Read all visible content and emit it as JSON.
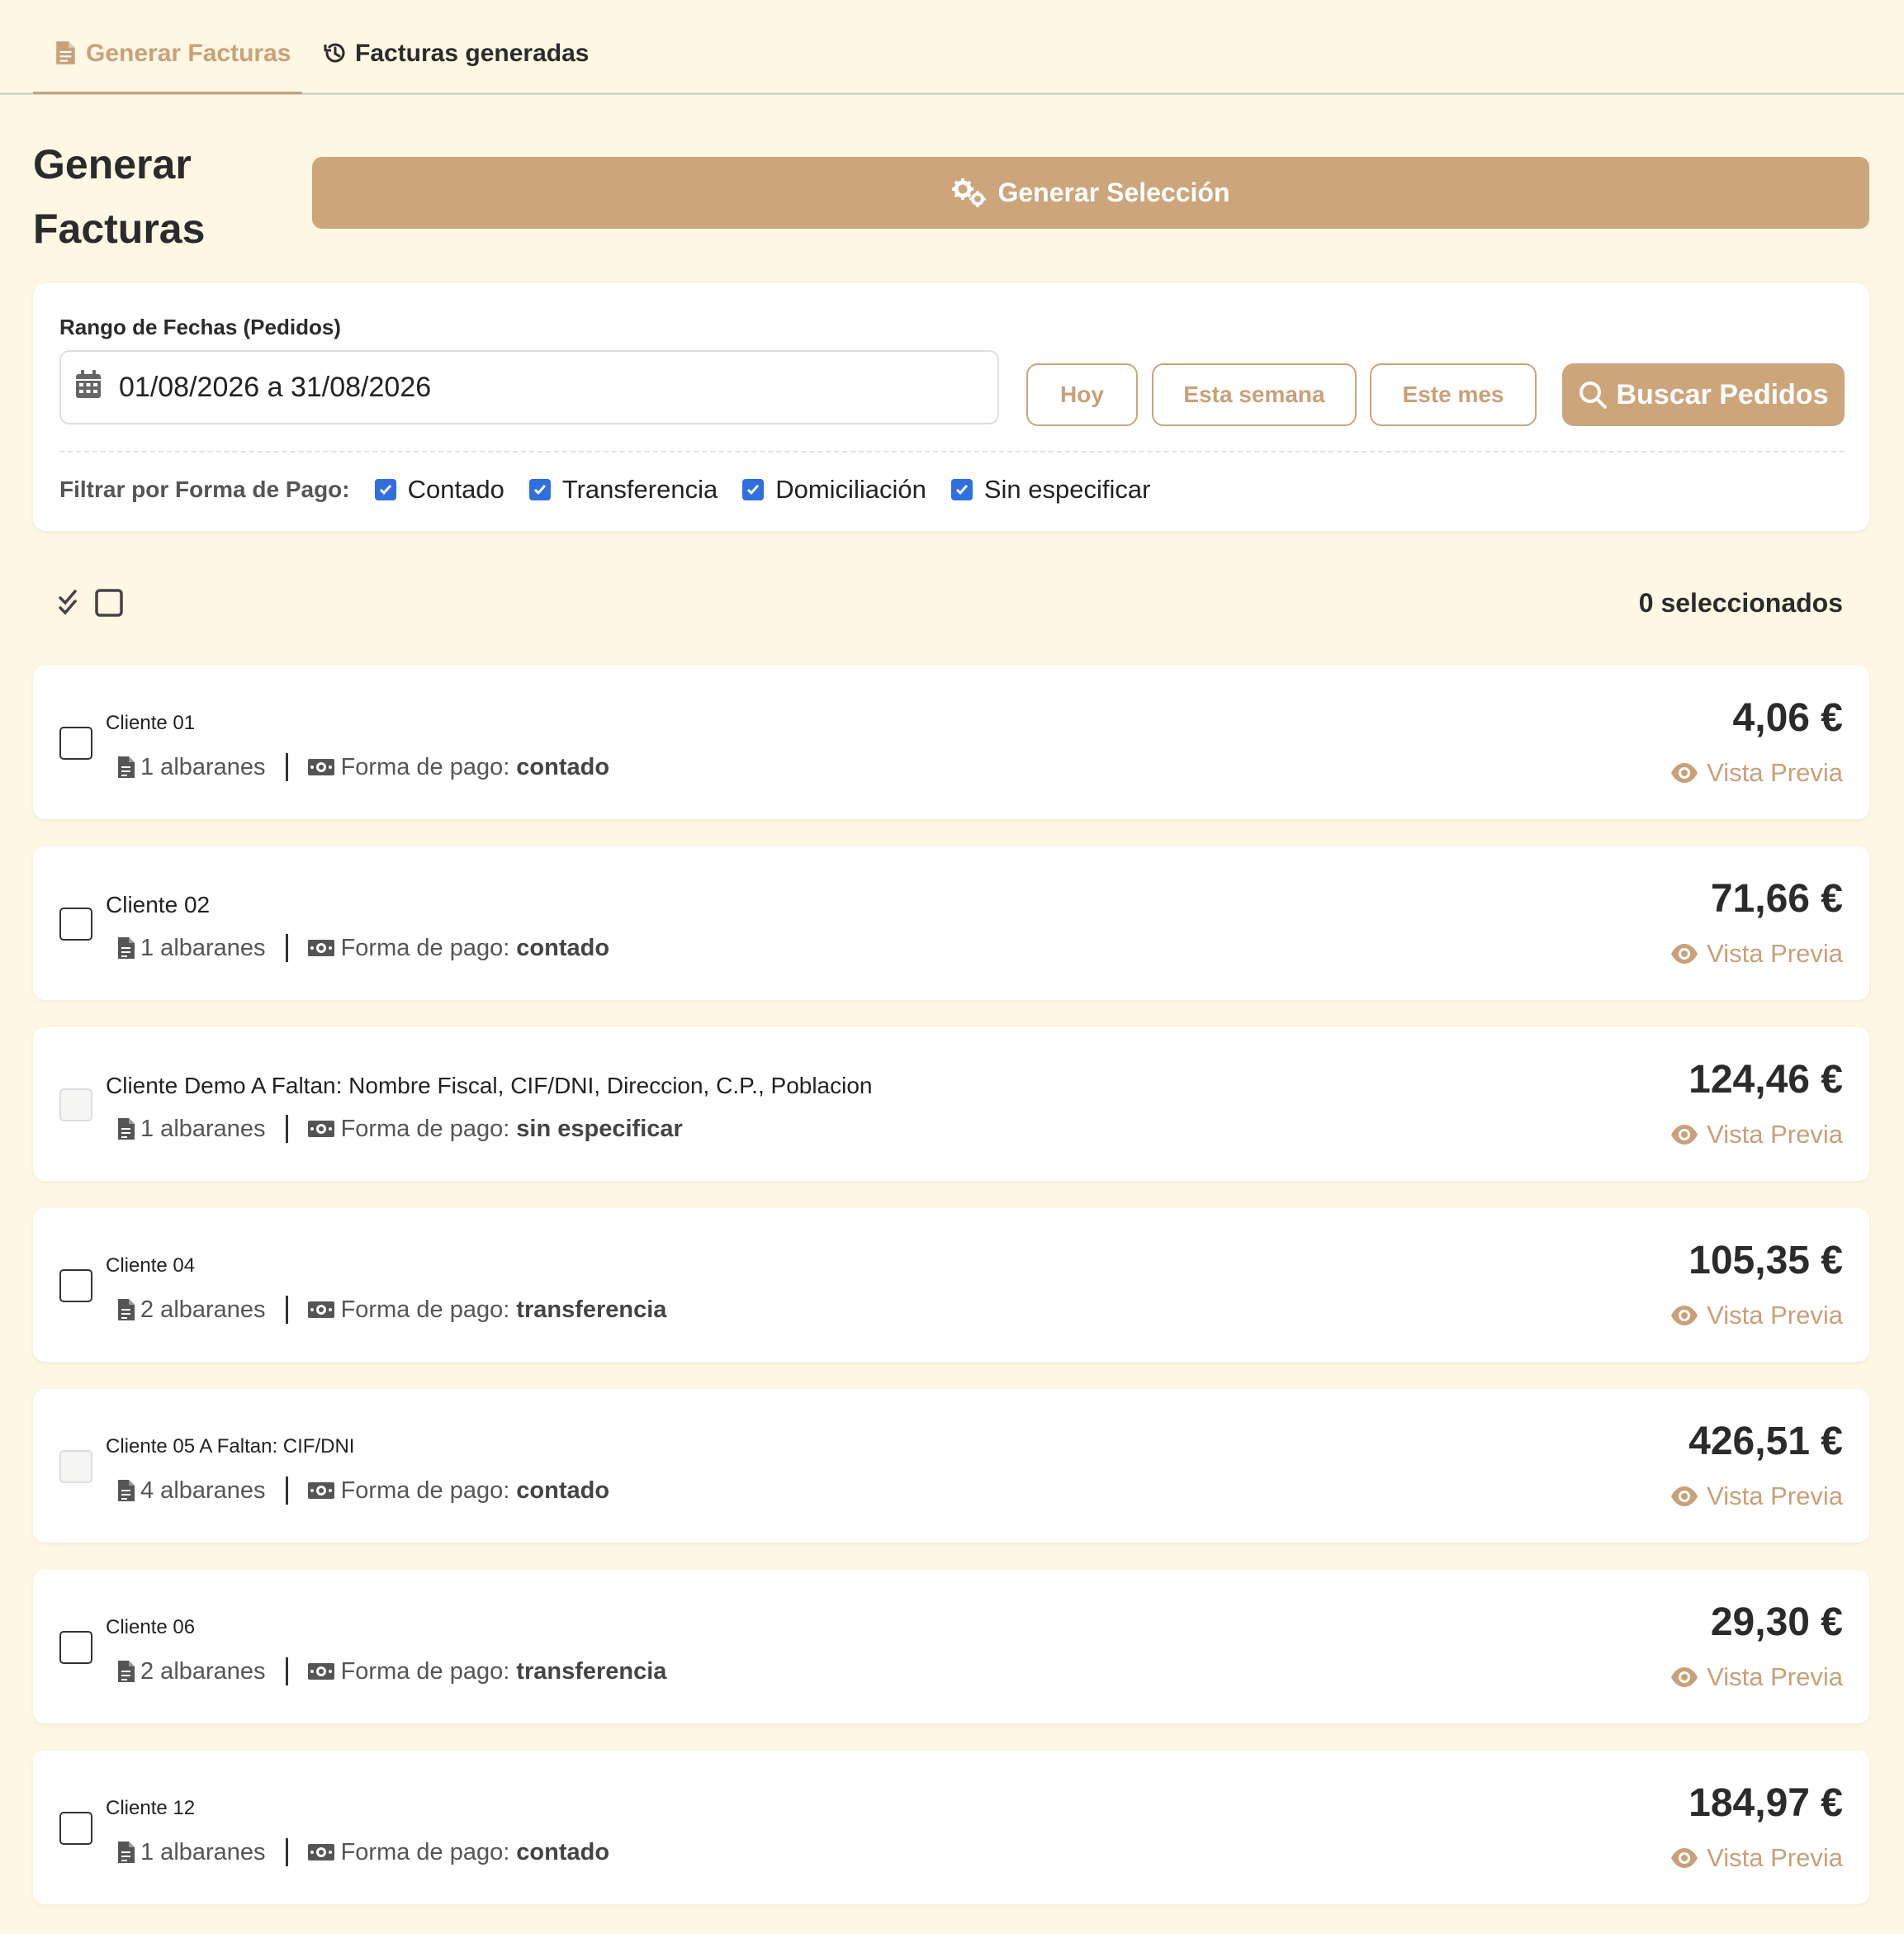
{
  "tabs": [
    {
      "label": "Generar Facturas",
      "icon": "file-invoice-icon",
      "active": true
    },
    {
      "label": "Facturas generadas",
      "icon": "history-icon",
      "active": false
    }
  ],
  "header": {
    "title": "Generar Facturas",
    "generate_button": "Generar Selección"
  },
  "filters": {
    "range_label": "Rango de Fechas (Pedidos)",
    "date_range_value": "01/08/2026 a 31/08/2026",
    "quick_buttons": [
      "Hoy",
      "Esta semana",
      "Este mes"
    ],
    "search_button": "Buscar Pedidos",
    "payment_label": "Filtrar por Forma de Pago:",
    "payment_options": [
      {
        "label": "Contado",
        "checked": true
      },
      {
        "label": "Transferencia",
        "checked": true
      },
      {
        "label": "Domiciliación",
        "checked": true
      },
      {
        "label": "Sin especificar",
        "checked": true
      }
    ]
  },
  "selection": {
    "count_text": "0 seleccionados"
  },
  "common": {
    "payment_prefix": "Forma de pago:",
    "preview_label": "Vista Previa"
  },
  "clients": [
    {
      "name": "Cliente 01",
      "albaranes": "1 albaranes",
      "payment": "contado",
      "amount": "4,06 €",
      "disabled": false
    },
    {
      "name": "Cliente 02",
      "albaranes": "1 albaranes",
      "payment": "contado",
      "amount": "71,66 €",
      "disabled": false
    },
    {
      "name": "Cliente Demo A Faltan: Nombre Fiscal, CIF/DNI, Direccion, C.P., Poblacion",
      "albaranes": "1 albaranes",
      "payment": "sin especificar",
      "amount": "124,46 €",
      "disabled": true
    },
    {
      "name": "Cliente 04",
      "albaranes": "2 albaranes",
      "payment": "transferencia",
      "amount": "105,35 €",
      "disabled": false
    },
    {
      "name": "Cliente 05 A Faltan: CIF/DNI",
      "albaranes": "4 albaranes",
      "payment": "contado",
      "amount": "426,51 €",
      "disabled": true
    },
    {
      "name": "Cliente 06",
      "albaranes": "2 albaranes",
      "payment": "transferencia",
      "amount": "29,30 €",
      "disabled": false
    },
    {
      "name": "Cliente 12",
      "albaranes": "1 albaranes",
      "payment": "contado",
      "amount": "184,97 €",
      "disabled": false
    }
  ],
  "colors": {
    "background": "#fdf7e4",
    "accent": "#cca57b",
    "checkbox": "#2f6fde"
  }
}
